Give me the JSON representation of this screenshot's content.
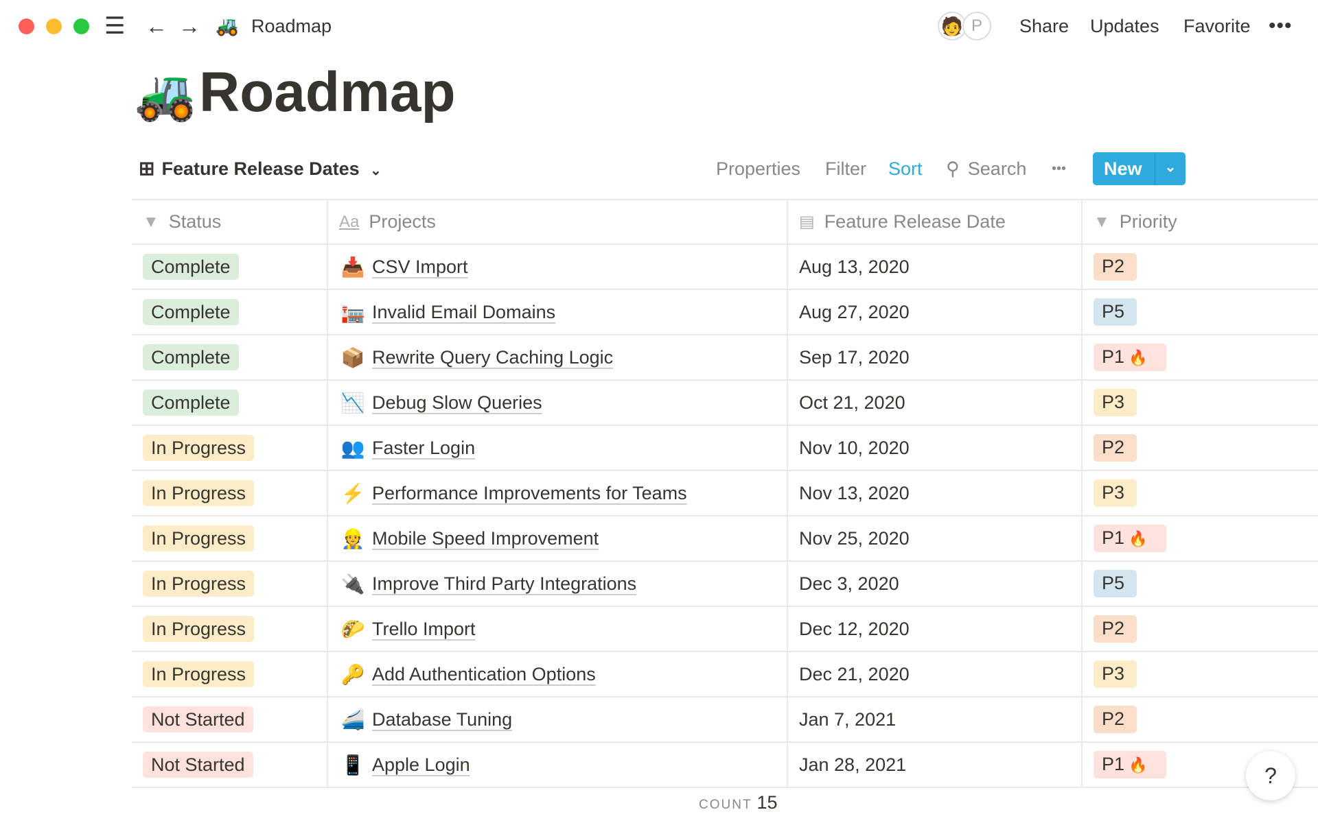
{
  "titlebar": {
    "title": "Roadmap",
    "icon": "tractor-icon",
    "avatar_letter": "P",
    "share": "Share",
    "updates": "Updates",
    "favorite": "Favorite"
  },
  "page": {
    "title": "Roadmap",
    "emoji": "🚜"
  },
  "view": {
    "name": "Feature Release Dates",
    "properties": "Properties",
    "filter": "Filter",
    "sort": "Sort",
    "search": "Search",
    "new": "New",
    "accent": "#2eaadc"
  },
  "table": {
    "headers": [
      "Status",
      "Projects",
      "Feature Release Date",
      "Priority"
    ],
    "rows": [
      {
        "status": "Complete",
        "emoji": "📥",
        "project": "CSV Import",
        "date": "Aug 13, 2020",
        "priority": "P2",
        "fire": ""
      },
      {
        "status": "Complete",
        "emoji": "🏣",
        "project": "Invalid Email Domains",
        "date": "Aug 27, 2020",
        "priority": "P5",
        "fire": ""
      },
      {
        "status": "Complete",
        "emoji": "📦",
        "project": "Rewrite Query Caching Logic",
        "date": "Sep 17, 2020",
        "priority": "P1",
        "fire": "🔥"
      },
      {
        "status": "Complete",
        "emoji": "📉",
        "project": "Debug Slow Queries",
        "date": "Oct 21, 2020",
        "priority": "P3",
        "fire": ""
      },
      {
        "status": "In Progress",
        "emoji": "👥",
        "project": "Faster Login",
        "date": "Nov 10, 2020",
        "priority": "P2",
        "fire": ""
      },
      {
        "status": "In Progress",
        "emoji": "⚡",
        "project": "Performance Improvements for Teams",
        "date": "Nov 13, 2020",
        "priority": "P3",
        "fire": ""
      },
      {
        "status": "In Progress",
        "emoji": "👷",
        "project": "Mobile Speed Improvement",
        "date": "Nov 25, 2020",
        "priority": "P1",
        "fire": "🔥"
      },
      {
        "status": "In Progress",
        "emoji": "🔌",
        "project": "Improve Third Party Integrations",
        "date": "Dec 3, 2020",
        "priority": "P5",
        "fire": ""
      },
      {
        "status": "In Progress",
        "emoji": "🌮",
        "project": "Trello Import",
        "date": "Dec 12, 2020",
        "priority": "P2",
        "fire": ""
      },
      {
        "status": "In Progress",
        "emoji": "🔑",
        "project": "Add Authentication Options",
        "date": "Dec 21, 2020",
        "priority": "P3",
        "fire": ""
      },
      {
        "status": "Not Started",
        "emoji": "🚄",
        "project": "Database Tuning",
        "date": "Jan 7, 2021",
        "priority": "P2",
        "fire": ""
      },
      {
        "status": "Not Started",
        "emoji": "📱",
        "project": "Apple Login",
        "date": "Jan 28, 2021",
        "priority": "P1",
        "fire": "🔥"
      }
    ]
  },
  "footer": {
    "count_label": "COUNT",
    "count": "15",
    "help": "?"
  },
  "colors": {
    "Complete": "#dbeddb",
    "In Progress": "#fdecc8",
    "Not Started": "#ffe2dd",
    "P1": "#ffe2dd",
    "P2": "#fadec9",
    "P3": "#fdecc8",
    "P5": "#d3e5ef"
  }
}
